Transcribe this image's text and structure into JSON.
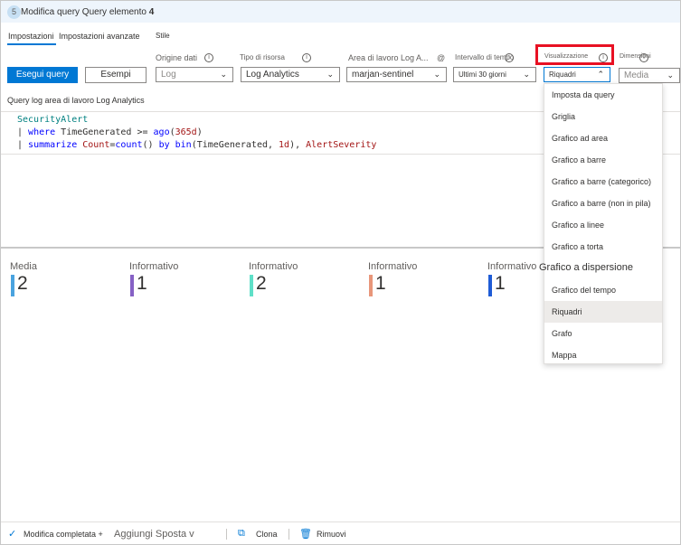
{
  "header": {
    "step_number": "5",
    "title": "Modifica query  Query elemento",
    "item_number": "4"
  },
  "tabs": [
    {
      "label": "Impostazioni"
    },
    {
      "label": "Impostazioni avanzate"
    },
    {
      "label": "Stile"
    }
  ],
  "toolbar": {
    "run_label": "Esegui query",
    "samples_label": "Esempi"
  },
  "fields": {
    "data_source": {
      "label": "Origine dati",
      "value": "Log"
    },
    "resource_type": {
      "label": "Tipo di risorsa",
      "value": "Log Analytics"
    },
    "workspace": {
      "label": "Area di lavoro  Log A...",
      "value": "marjan-sentinel"
    },
    "time_range": {
      "label": "Intervallo di tempo",
      "value": "Ultimi 30 giorni"
    },
    "visualization": {
      "label": "Visualizzazione",
      "value": "Riquadri"
    },
    "size": {
      "label": "Dimensioni",
      "value": "Media"
    }
  },
  "query": {
    "label": "Query log area di lavoro Log Analytics",
    "line1": "SecurityAlert",
    "line2_pipe": "| ",
    "line2_kw": "where",
    "line2_mid": " TimeGenerated >= ",
    "line2_fn": "ago",
    "line2_open": "(",
    "line2_arg": "365d",
    "line2_close": ")",
    "line3_pipe": "| ",
    "line3_kw": "summarize",
    "line3_a": " Count",
    "line3_b": "=",
    "line3_fn": "count",
    "line3_c": "() ",
    "line3_by": "by",
    "line3_d": " ",
    "line3_bin": "bin",
    "line3_e": "(TimeGenerated, ",
    "line3_f": "1d",
    "line3_g": "), ",
    "line3_h": "AlertSeverity"
  },
  "tiles": [
    {
      "label": "Media",
      "value": "2",
      "color": "#4aa3df"
    },
    {
      "label": "Informativo",
      "value": "1",
      "color": "#8661c5"
    },
    {
      "label": "Informativo",
      "value": "2",
      "color": "#5fe0c8"
    },
    {
      "label": "Informativo",
      "value": "1",
      "color": "#e8967a"
    },
    {
      "label": "Informativo",
      "value": "1",
      "color": "#1f5cd6"
    }
  ],
  "visualization_menu": {
    "items": [
      "Imposta da query",
      "Griglia",
      "Grafico ad area",
      "Grafico a barre",
      "Grafico a barre (categorico)",
      "Grafico a barre (non in pila)",
      "Grafico a linee",
      "Grafico a torta",
      "Grafico a dispersione",
      "Grafico del tempo",
      "Riquadri",
      "Grafo",
      "Mappa"
    ],
    "selected": "Riquadri"
  },
  "footer": {
    "done_label": "Modifica completata +",
    "add_label": "Aggiungi Sposta v",
    "clone_label": "Clona",
    "remove_label": "Rimuovi"
  },
  "colors": {
    "accent": "#0078d4",
    "highlight": "#e81123"
  }
}
